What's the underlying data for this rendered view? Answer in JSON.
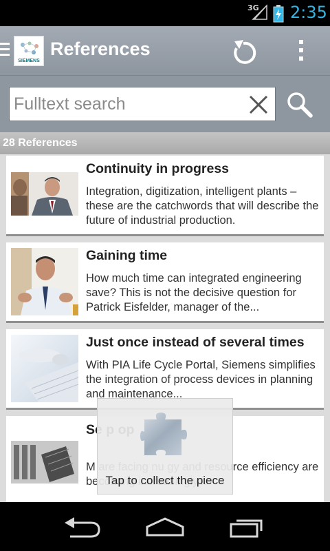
{
  "status_bar": {
    "network": "3G",
    "time": "2:35"
  },
  "action_bar": {
    "title": "References",
    "logo_text": "SIEMENS"
  },
  "search": {
    "placeholder": "Fulltext search"
  },
  "list_header": {
    "count_label": "28 References"
  },
  "references": [
    {
      "title": "Continuity in progress",
      "description": "Integration, digitization, intelligent plants – these are the catchwords that will describe the future of industrial production."
    },
    {
      "title": "Gaining time",
      "description": "How much time can integrated engineering save? This is not the decisive question for Patrick Eisfelder, manager of the..."
    },
    {
      "title": "Just once instead of several times",
      "description": "With PIA Life Cycle Portal, Siemens simplifies the integration of process devices in planning and maintenance..."
    },
    {
      "title": "Se                                  p op",
      "description": "M                                 are facing nu                              gy and resource efficiency are becoming increasingly..."
    }
  ],
  "toast": {
    "message": "Tap to collect the piece"
  },
  "colors": {
    "accent": "#33b5e5",
    "action_bar": "#97a0aa",
    "card_background": "#ffffff"
  }
}
